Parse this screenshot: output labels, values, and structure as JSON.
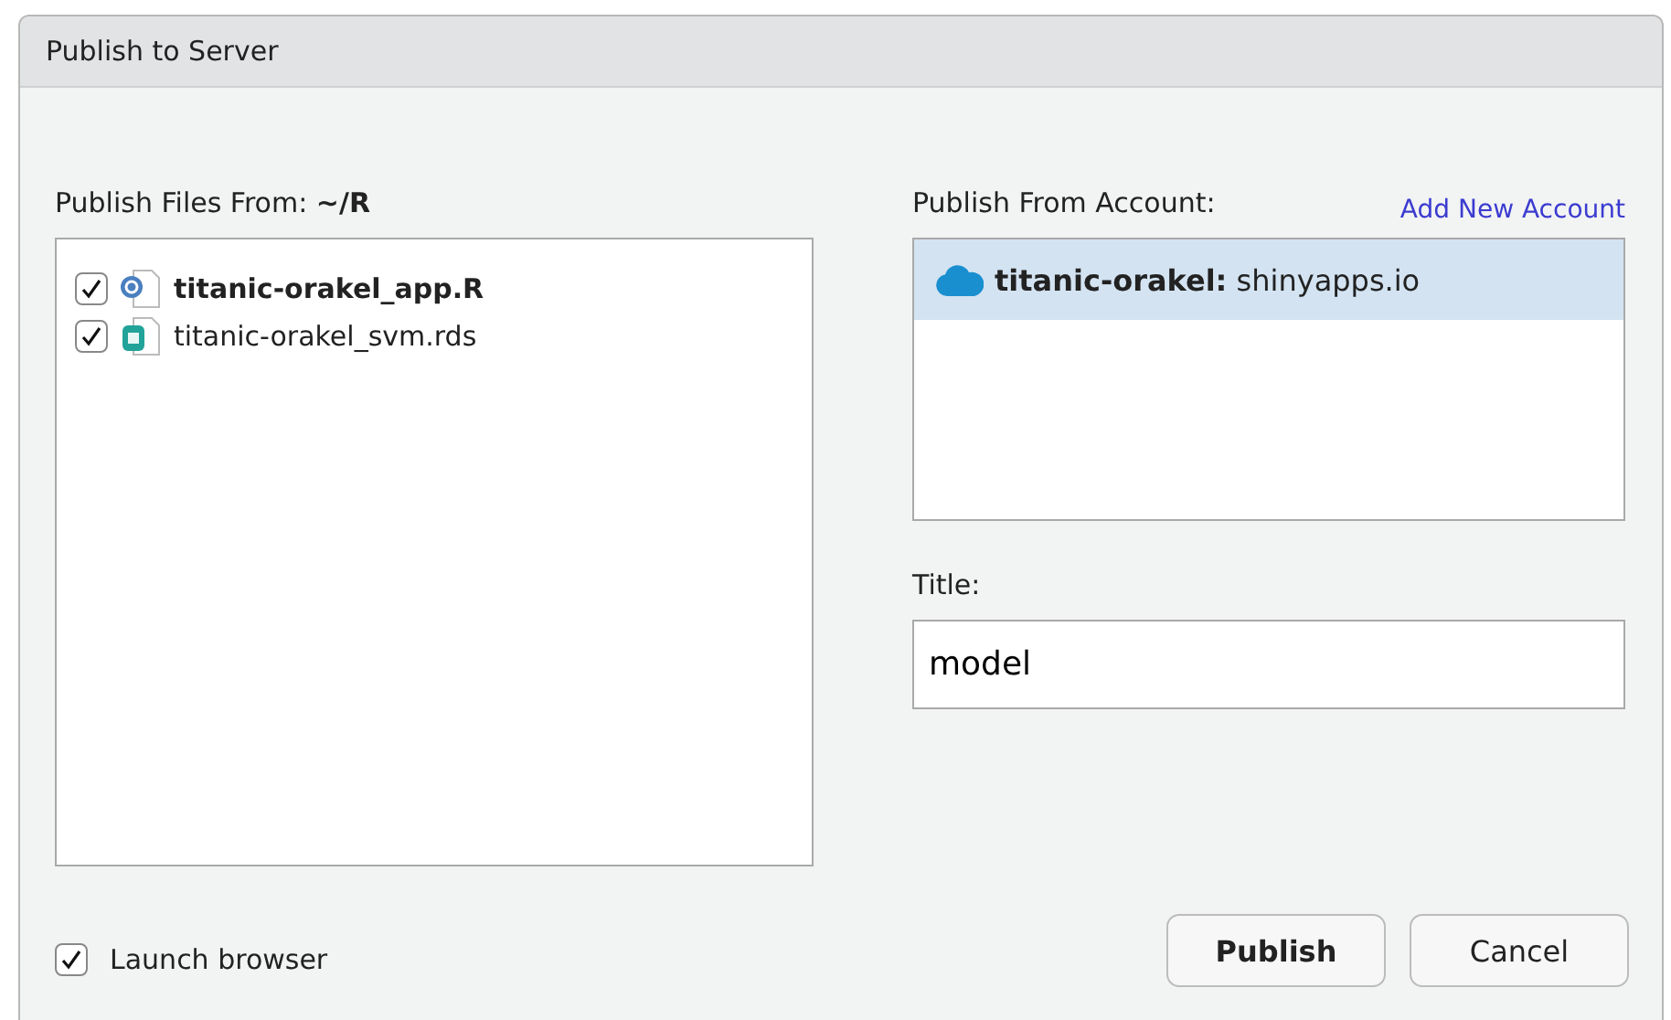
{
  "window": {
    "title": "Publish to Server"
  },
  "files": {
    "label": "Publish Files From: **~/R**",
    "items": [
      {
        "name": "titanic-orakel_app.R",
        "kind": "script",
        "checked": true,
        "primary": true
      },
      {
        "name": "titanic-orakel_svm.rds",
        "kind": "data",
        "checked": true,
        "primary": false
      }
    ]
  },
  "account": {
    "label": "Publish From Account:",
    "add_link": "Add New Account",
    "items": [
      {
        "text": "**titanic-orakel:** shinyapps.io",
        "selected": true
      }
    ]
  },
  "title_field": {
    "label": "Title:",
    "value": "model"
  },
  "launch_browser": {
    "label": "Launch browser",
    "checked": true
  },
  "buttons": [
    {
      "label": "Publish",
      "kind": "primary"
    },
    {
      "label": "Cancel",
      "kind": "secondary"
    }
  ]
}
